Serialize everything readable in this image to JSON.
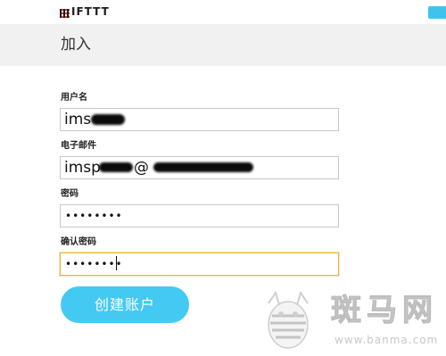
{
  "topbar": {
    "logo_text": "IFTTT"
  },
  "header": {
    "title": "加入"
  },
  "form": {
    "username": {
      "label": "用户名",
      "value_visible": "ims"
    },
    "email": {
      "label": "电子邮件",
      "value_visible_prefix": "imsp",
      "value_visible_at": "@"
    },
    "password": {
      "label": "密码",
      "value_masked": "••••••••"
    },
    "confirm_password": {
      "label": "确认密码",
      "value_masked": "••••••••"
    },
    "submit_label": "创建账户"
  },
  "watermark": {
    "text": "斑马网",
    "url": "www.banma.com"
  },
  "colors": {
    "accent": "#44c9f2",
    "focus_border": "#e8b446",
    "header_band": "#f1f1f1"
  }
}
